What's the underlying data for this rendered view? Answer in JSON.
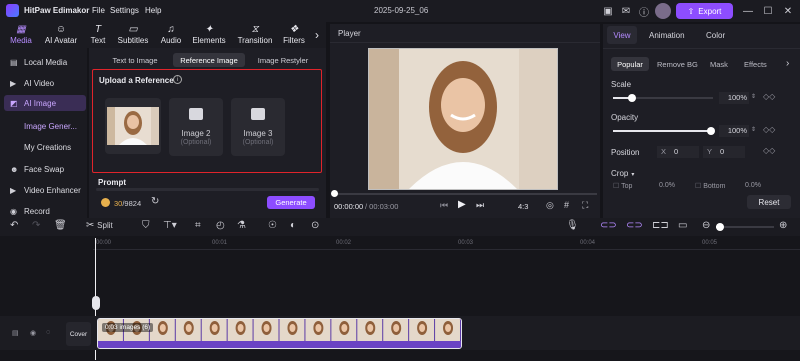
{
  "app": {
    "name": "HitPaw Edimakor",
    "menu": [
      "File",
      "Settings",
      "Help"
    ],
    "project_date": "2025-09-25_06",
    "export_label": "Export"
  },
  "toolbar": {
    "tools": [
      "Media",
      "AI Avatar",
      "Text",
      "Subtitles",
      "Audio",
      "Elements",
      "Transition",
      "Filters"
    ],
    "active": "Media"
  },
  "sidebar": {
    "items": [
      "Local Media",
      "AI Video",
      "AI Image",
      "Image Gener...",
      "My Creations",
      "Face Swap",
      "Video Enhancer",
      "Record"
    ],
    "active": "AI Image"
  },
  "media_panel": {
    "tabs": [
      "Text to Image",
      "Reference Image",
      "Image Restyler"
    ],
    "active_tab": "Reference Image",
    "upload_title": "Upload a Reference",
    "slots": [
      {
        "title": "Image 2",
        "subtitle": "(Optional)"
      },
      {
        "title": "Image 3",
        "subtitle": "(Optional)"
      }
    ],
    "prompt_label": "Prompt",
    "credits_used": "30",
    "credits_total": "/9824",
    "generate_label": "Generate"
  },
  "player": {
    "title": "Player",
    "current_time": "00:00:00",
    "total_time": "/ 00:03:00",
    "aspect": "4:3"
  },
  "right_panel": {
    "tabs": [
      "View",
      "Animation",
      "Color"
    ],
    "active_tab": "View",
    "subtabs": [
      "Popular",
      "Remove BG",
      "Mask",
      "Effects"
    ],
    "active_subtab": "Popular",
    "scale_label": "Scale",
    "scale_value": "100%",
    "opacity_label": "Opacity",
    "opacity_value": "100%",
    "position_label": "Position",
    "pos_x_label": "X",
    "pos_x": "0",
    "pos_y_label": "Y",
    "pos_y": "0",
    "crop_label": "Crop",
    "crop_top_label": "Top",
    "crop_top": "0.0%",
    "crop_bottom_label": "Bottom",
    "crop_bottom": "0.0%",
    "reset_label": "Reset"
  },
  "timeline": {
    "split_label": "Split",
    "ticks": [
      "00:00",
      "00:01",
      "00:02",
      "00:03",
      "00:04",
      "00:05"
    ],
    "cover_label": "Cover",
    "clip_label": "0:03 images (6)",
    "clip_frames": 14
  },
  "colors": {
    "accent": "#8d4dff",
    "highlight_box": "#e0242b",
    "bg": "#141419"
  }
}
